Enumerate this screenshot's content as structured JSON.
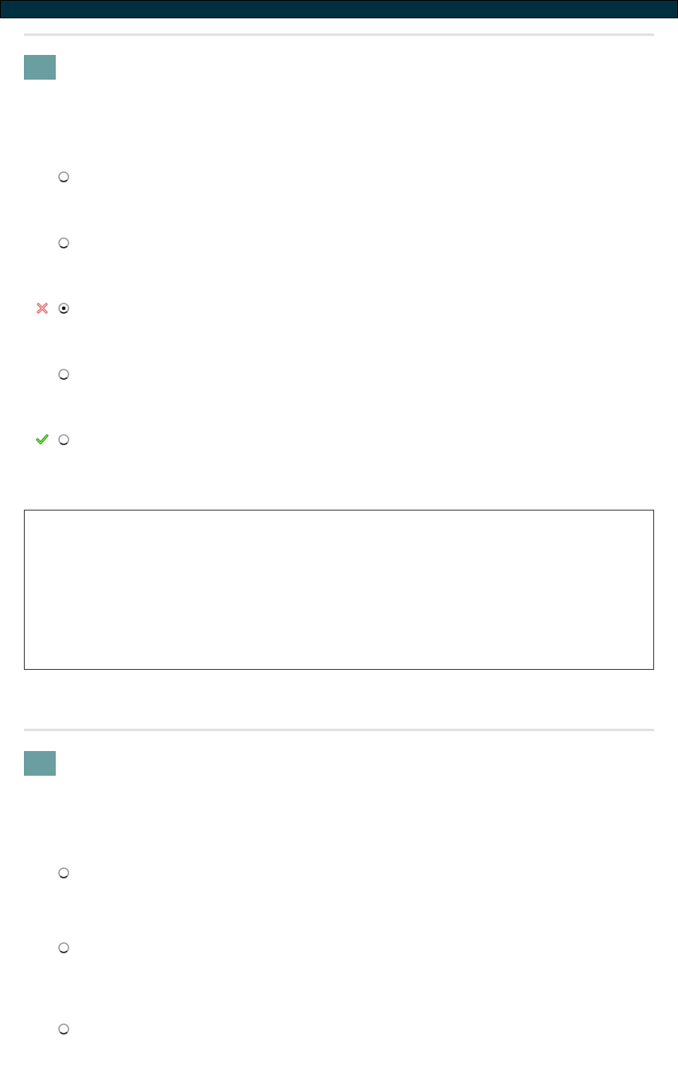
{
  "header": {
    "title": ""
  },
  "questions": [
    {
      "number": "",
      "prompt": "",
      "options": [
        {
          "label": "",
          "selected": false,
          "mark": "none"
        },
        {
          "label": "",
          "selected": false,
          "mark": "none"
        },
        {
          "label": "",
          "selected": true,
          "mark": "incorrect-x-icon"
        },
        {
          "label": "",
          "selected": false,
          "mark": "none"
        },
        {
          "label": "",
          "selected": false,
          "mark": "correct-check-icon"
        }
      ],
      "feedback": ""
    },
    {
      "number": "",
      "prompt": "",
      "options": [
        {
          "label": "",
          "selected": false,
          "mark": "none"
        },
        {
          "label": "",
          "selected": false,
          "mark": "none"
        },
        {
          "label": "",
          "selected": false,
          "mark": "none"
        }
      ]
    }
  ],
  "colors": {
    "header_bg": "#003040",
    "badge_bg": "#6a9ea0",
    "divider": "#e0e0e0",
    "incorrect": "#e07070",
    "correct": "#33cc11"
  }
}
